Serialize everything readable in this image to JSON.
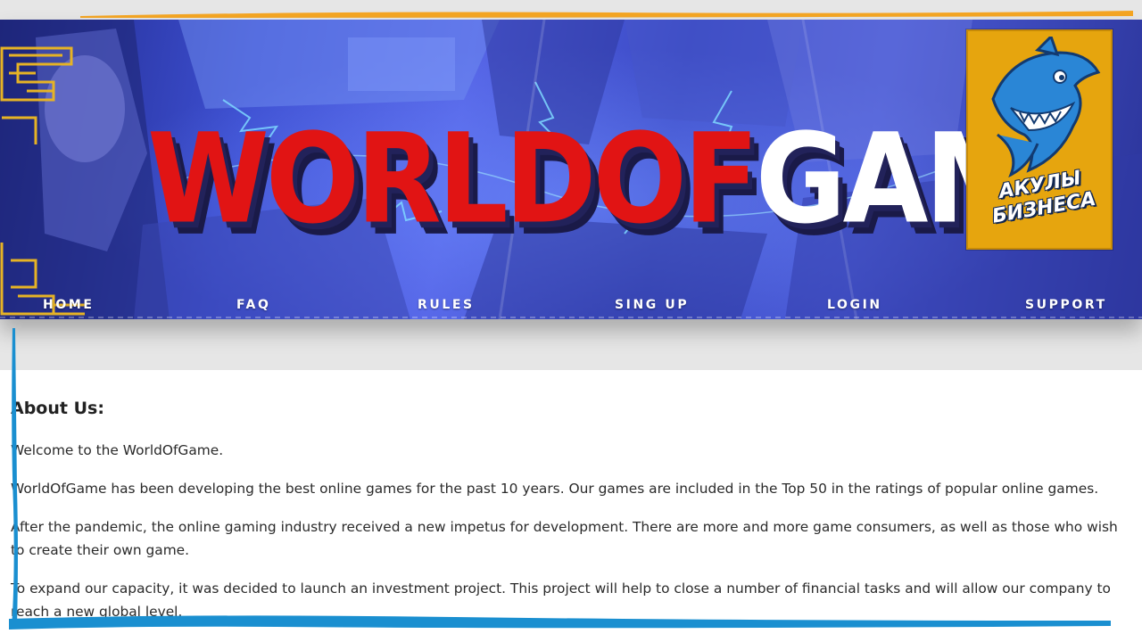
{
  "banner": {
    "logo_red": "WORLDOF",
    "logo_white": "GAME",
    "badge_line1": "АКУЛЫ",
    "badge_line2": "БИЗНЕСА"
  },
  "nav": {
    "items": [
      {
        "label": "HOME"
      },
      {
        "label": "FAQ"
      },
      {
        "label": "RULES"
      },
      {
        "label": "SING UP"
      },
      {
        "label": "LOGIN"
      },
      {
        "label": "SUPPORT"
      }
    ]
  },
  "content": {
    "heading": "About Us:",
    "paragraphs": [
      "Welcome to the WorldOfGame.",
      "WorldOfGame has been developing the best online games for the past 10 years. Our games are included in the Top 50 in the ratings of popular online games.",
      "After the pandemic, the online gaming industry received a new impetus for development. There are more and more game consumers, as well as those who wish to create their own game.",
      "To expand our capacity, it was decided to launch an investment project. This project will help to close a number of financial tasks and will allow our company to reach a new global level."
    ]
  },
  "colors": {
    "logo_red": "#e11414",
    "badge_orange": "#e6a50e",
    "accent_orange_line": "#f5a623",
    "brush_blue": "#1a8fd0"
  }
}
